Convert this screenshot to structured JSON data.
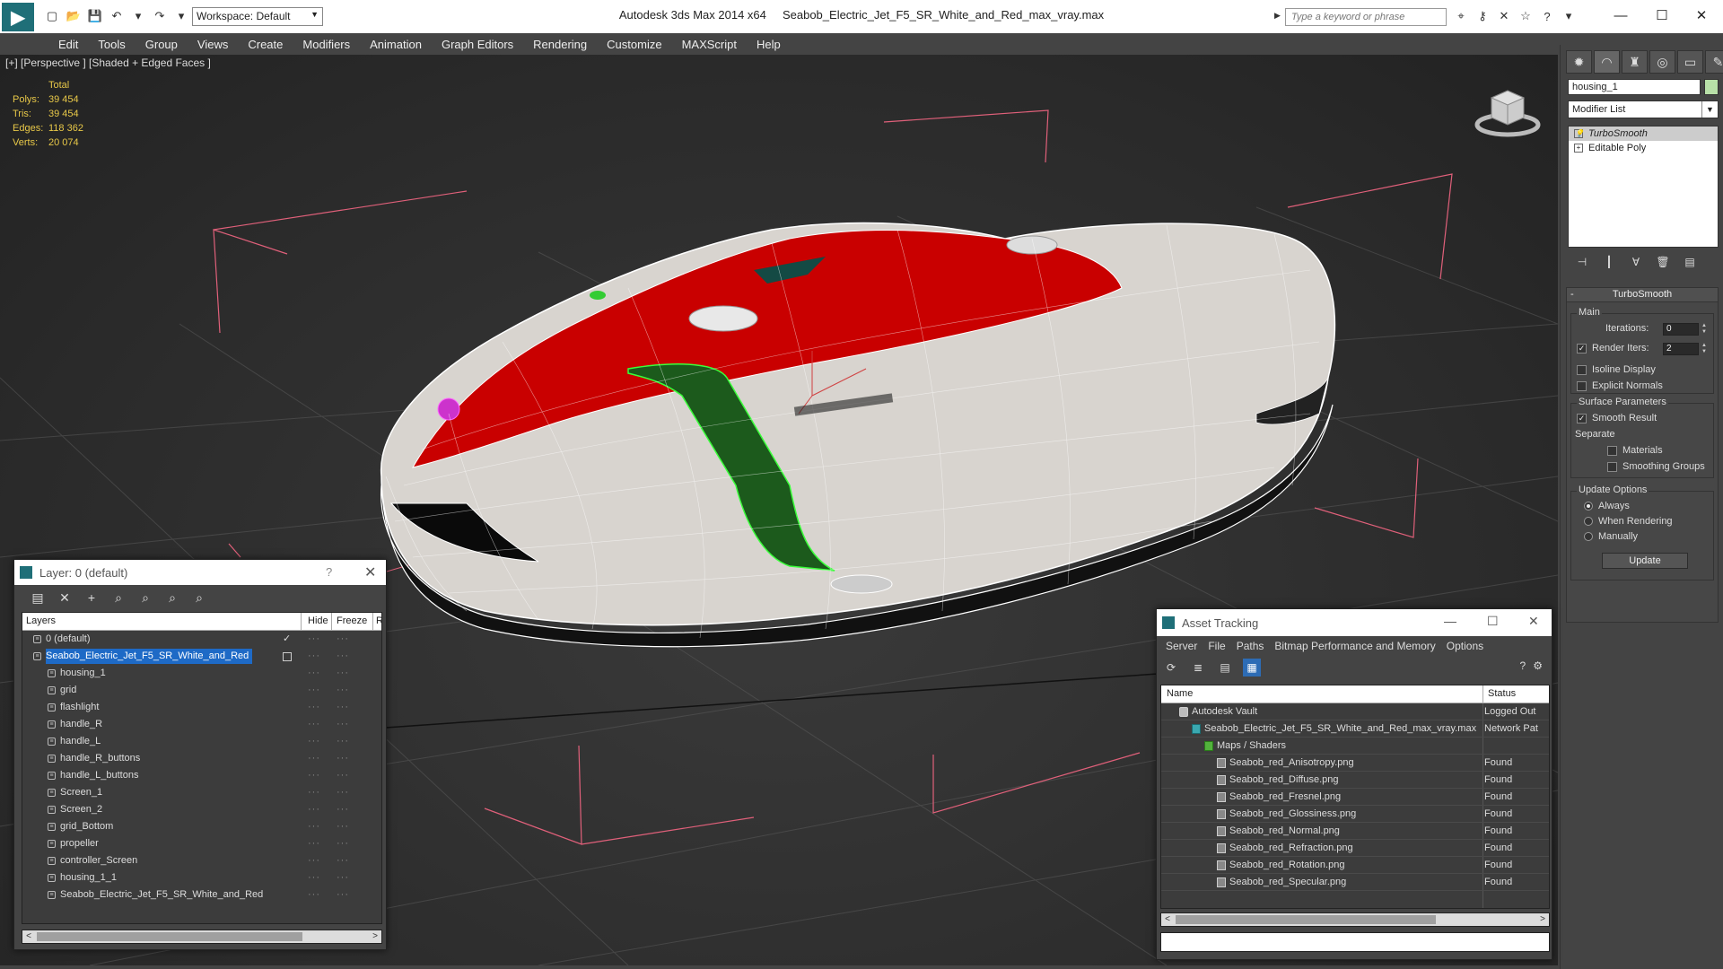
{
  "titlebar": {
    "app_name": "Autodesk 3ds Max  2014 x64",
    "file_name": "Seabob_Electric_Jet_F5_SR_White_and_Red_max_vray.max",
    "workspace": "Workspace: Default",
    "search_placeholder": "Type a keyword or phrase"
  },
  "menu": [
    "Edit",
    "Tools",
    "Group",
    "Views",
    "Create",
    "Modifiers",
    "Animation",
    "Graph Editors",
    "Rendering",
    "Customize",
    "MAXScript",
    "Help"
  ],
  "viewport": {
    "label": "[+] [Perspective ] [Shaded + Edged Faces ]",
    "stats": {
      "header": "Total",
      "rows": [
        {
          "k": "Polys:",
          "v": "39 454"
        },
        {
          "k": "Tris:",
          "v": "39 454"
        },
        {
          "k": "Edges:",
          "v": "118 362"
        },
        {
          "k": "Verts:",
          "v": "20 074"
        }
      ]
    }
  },
  "command_panel": {
    "object_name": "housing_1",
    "modifier_list": "Modifier List",
    "stack": [
      "TurboSmooth",
      "Editable Poly"
    ],
    "rollout_title": "TurboSmooth",
    "main": {
      "title": "Main",
      "iterations_label": "Iterations:",
      "iterations_value": "0",
      "render_iters_label": "Render Iters:",
      "render_iters_value": "2",
      "isoline": "Isoline Display",
      "explicit": "Explicit Normals"
    },
    "surface": {
      "title": "Surface Parameters",
      "smooth": "Smooth Result",
      "separate": "Separate",
      "materials": "Materials",
      "smoothing_groups": "Smoothing Groups"
    },
    "update": {
      "title": "Update Options",
      "always": "Always",
      "when_rendering": "When Rendering",
      "manually": "Manually",
      "button": "Update"
    }
  },
  "layer_dialog": {
    "title": "Layer: 0 (default)",
    "help": "?",
    "columns": {
      "layers": "Layers",
      "hide": "Hide",
      "freeze": "Freeze",
      "render": "Re"
    },
    "rows": [
      {
        "name": "0 (default)",
        "level": 0
      },
      {
        "name": "Seabob_Electric_Jet_F5_SR_White_and_Red",
        "level": 0
      },
      {
        "name": "housing_1",
        "level": 1
      },
      {
        "name": "grid",
        "level": 1
      },
      {
        "name": "flashlight",
        "level": 1
      },
      {
        "name": "handle_R",
        "level": 1
      },
      {
        "name": "handle_L",
        "level": 1
      },
      {
        "name": "handle_R_buttons",
        "level": 1
      },
      {
        "name": "handle_L_buttons",
        "level": 1
      },
      {
        "name": "Screen_1",
        "level": 1
      },
      {
        "name": "Screen_2",
        "level": 1
      },
      {
        "name": "grid_Bottom",
        "level": 1
      },
      {
        "name": "propeller",
        "level": 1
      },
      {
        "name": "controller_Screen",
        "level": 1
      },
      {
        "name": "housing_1_1",
        "level": 1
      },
      {
        "name": "Seabob_Electric_Jet_F5_SR_White_and_Red",
        "level": 1
      }
    ]
  },
  "asset_dialog": {
    "title": "Asset Tracking",
    "menu": [
      "Server",
      "File",
      "Paths",
      "Bitmap Performance and Memory",
      "Options"
    ],
    "columns": {
      "name": "Name",
      "status": "Status"
    },
    "rows": [
      {
        "name": "Autodesk Vault",
        "status": "Logged Out",
        "indent": 1,
        "icon": "vault"
      },
      {
        "name": "Seabob_Electric_Jet_F5_SR_White_and_Red_max_vray.max",
        "status": "Network Pat",
        "indent": 2,
        "icon": "teal"
      },
      {
        "name": "Maps / Shaders",
        "status": "",
        "indent": 3,
        "icon": "green"
      },
      {
        "name": "Seabob_red_Anisotropy.png",
        "status": "Found",
        "indent": 4,
        "icon": "file"
      },
      {
        "name": "Seabob_red_Diffuse.png",
        "status": "Found",
        "indent": 4,
        "icon": "file"
      },
      {
        "name": "Seabob_red_Fresnel.png",
        "status": "Found",
        "indent": 4,
        "icon": "file"
      },
      {
        "name": "Seabob_red_Glossiness.png",
        "status": "Found",
        "indent": 4,
        "icon": "file"
      },
      {
        "name": "Seabob_red_Normal.png",
        "status": "Found",
        "indent": 4,
        "icon": "file"
      },
      {
        "name": "Seabob_red_Refraction.png",
        "status": "Found",
        "indent": 4,
        "icon": "file"
      },
      {
        "name": "Seabob_red_Rotation.png",
        "status": "Found",
        "indent": 4,
        "icon": "file"
      },
      {
        "name": "Seabob_red_Specular.png",
        "status": "Found",
        "indent": 4,
        "icon": "file"
      }
    ]
  },
  "colors": {
    "selection": "#1e6ac6",
    "stats": "#e8c848",
    "accent_red": "#d40000"
  }
}
